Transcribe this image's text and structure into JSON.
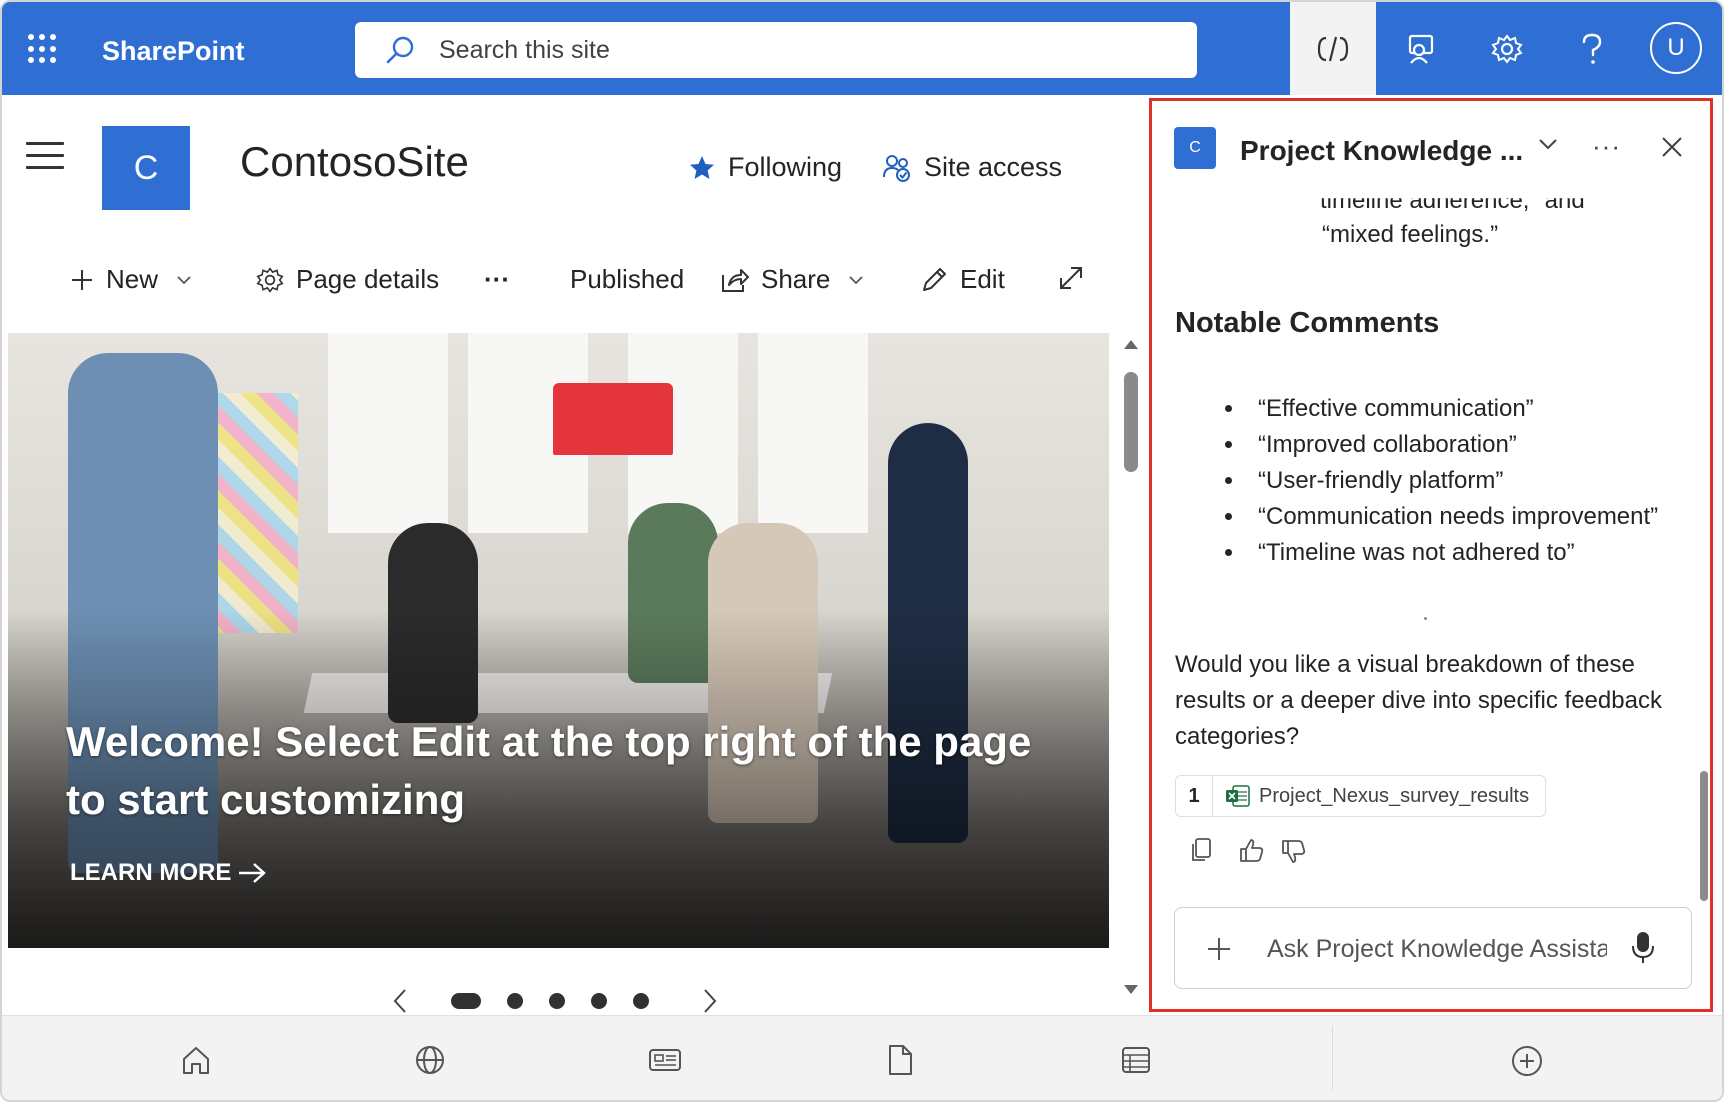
{
  "topbar": {
    "app_name": "SharePoint",
    "search_placeholder": "Search this site",
    "avatar_initial": "U",
    "colors": {
      "accent": "#2f6fd4",
      "code_button_bg": "#f3f3f3"
    }
  },
  "site": {
    "logo_letter": "C",
    "title": "ContosoSite",
    "following_label": "Following",
    "site_access_label": "Site access"
  },
  "commandbar": {
    "new_label": "New",
    "page_details_label": "Page details",
    "more_label": "···",
    "status_label": "Published",
    "share_label": "Share",
    "edit_label": "Edit"
  },
  "hero": {
    "headline": "Welcome! Select Edit at the top right of the page to start customizing",
    "link_label": "LEARN MORE"
  },
  "carousel": {
    "slide_count": 5,
    "active_index": 0
  },
  "bottom_nav": {
    "icons": [
      "home-icon",
      "globe-icon",
      "news-icon",
      "document-icon",
      "list-icon",
      "add-circle-icon"
    ]
  },
  "assistant": {
    "logo_letter": "C",
    "title": "Project Knowledge ...",
    "more_label": "···",
    "partial_line": "timeline adherence,\" and",
    "prev_text_tail": "“mixed feelings.”",
    "section_heading": "Notable Comments",
    "comments": [
      "“Effective communication”",
      "“Improved collaboration”",
      "“User-friendly platform”",
      "“Communication needs improvement”",
      "“Timeline was not adhered to”"
    ],
    "follow_up": "Would you like a visual breakdown of these results or a deeper dive into specific feedback categories?",
    "citation": {
      "number": "1",
      "file_name": "Project_Nexus_survey_results"
    },
    "input_placeholder": "Ask Project Knowledge Assista",
    "border_color": "#e0302a"
  }
}
